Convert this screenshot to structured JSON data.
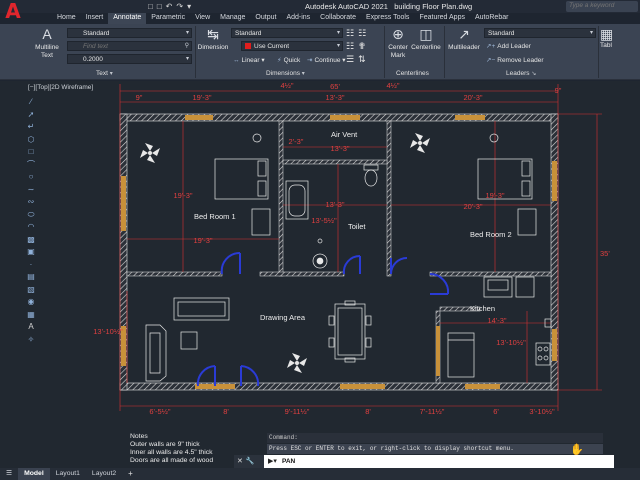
{
  "titlebar": {
    "app_title": "Autodesk AutoCAD 2021",
    "file_name": "building Floor Plan.dwg",
    "search_placeholder": "Type a keyword",
    "logo_glyph": "A"
  },
  "ribbon_tabs": [
    "Home",
    "Insert",
    "Annotate",
    "Parametric",
    "View",
    "Manage",
    "Output",
    "Add-ins",
    "Collaborate",
    "Express Tools",
    "Featured Apps",
    "AutoRebar"
  ],
  "active_tab": "Annotate",
  "ribbon": {
    "text_panel": {
      "multiline_text": "Multiline\nText",
      "style": "Standard",
      "find_placeholder": "Find text",
      "height": "0.2000",
      "label": "Text"
    },
    "dimensions_panel": {
      "dimension": "Dimension",
      "style": "Standard",
      "layer": "Use Current",
      "linear": "Linear",
      "quick": "Quick",
      "continue": "Continue",
      "label": "Dimensions"
    },
    "centerlines_panel": {
      "center_mark": "Center\nMark",
      "centerline": "Centerline",
      "label": "Centerlines"
    },
    "leaders_panel": {
      "multileader": "Multileader",
      "style": "Standard",
      "add_leader": "Add Leader",
      "remove_leader": "Remove Leader",
      "label": "Leaders"
    },
    "table_panel": {
      "table": "Tabl"
    }
  },
  "viewport_label": "[−][Top][2D Wireframe]",
  "drawing": {
    "rooms": {
      "bed_room_1": "Bed Room 1",
      "air_vent": "Air Vent",
      "toilet": "Toilet",
      "bed_room_2": "Bed Room 2",
      "drawing_area": "Drawing Area",
      "kitchen": "Kitchen"
    },
    "dims_top_overall": "65'",
    "dims_top": [
      "9\"",
      "19'-3\"",
      "4½\"",
      "13'-3\"",
      "4½\"",
      "20'-3\"",
      "9\""
    ],
    "dims_bottom": [
      "6'-5½\"",
      "8'",
      "9'-11½\"",
      "8'",
      "7'-11½\"",
      "6'",
      "3'-10½\""
    ],
    "dim_right": "35'",
    "dims_interior": {
      "br1_height": "19'-3\"",
      "br1_width": "19'-3\"",
      "vent_w1": "2'-3\"",
      "vent_w2": "13'-3\"",
      "toilet_w": "13'-3\"",
      "toilet_h": "13'-5½\"",
      "br2_height": "19'-3\"",
      "br2_width": "20'-3\"",
      "kitchen_w": "14'-3\"",
      "kitchen_h": "13'-10½\"",
      "drawing_h": "13'-10½\""
    }
  },
  "notes": {
    "heading": "Notes",
    "lines": [
      "Outer walls are 9\"  thick",
      "Inner all walls are 4.5\" thick",
      "Doors are all made of wood"
    ]
  },
  "command": {
    "history_label": "Command:",
    "history_line": "Press ESC or ENTER to exit, or right-click to display shortcut menu.",
    "input_value": "PAN"
  },
  "layout_tabs": [
    "Model",
    "Layout1",
    "Layout2"
  ],
  "active_layout": "Model"
}
